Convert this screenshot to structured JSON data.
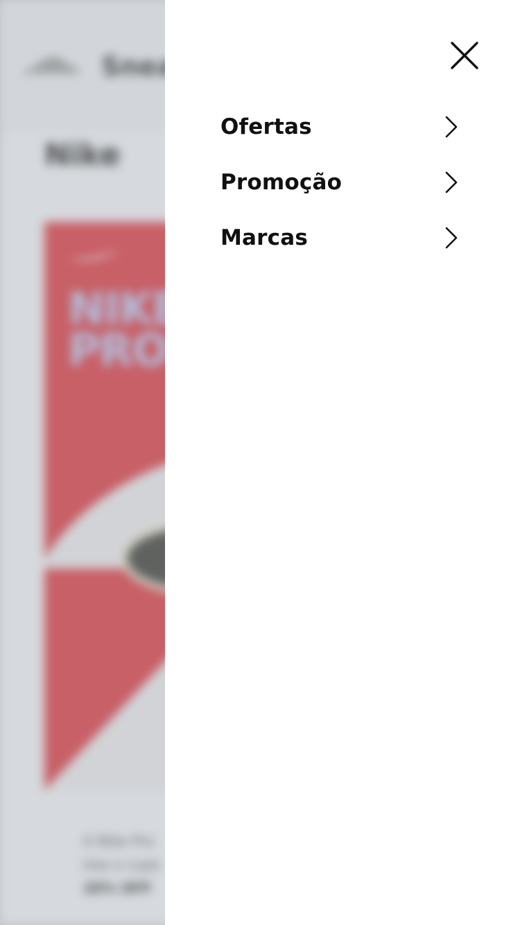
{
  "background_page": {
    "brand_word": "Snea",
    "title": "Nike",
    "banner_text_line1": "NIKE",
    "banner_text_line2": "PRO",
    "description_line1": "A Nike Pro",
    "description_line2": "Use o cupo",
    "description_line3": "20% OFF"
  },
  "drawer": {
    "close_icon": "close-icon",
    "menu": [
      {
        "label": "Ofertas",
        "icon": "chevron-right-icon"
      },
      {
        "label": "Promoção",
        "icon": "chevron-right-icon"
      },
      {
        "label": "Marcas",
        "icon": "chevron-right-icon"
      }
    ]
  },
  "colors": {
    "drawer_bg": "#ffffff",
    "text": "#111111",
    "banner_red": "#d9363e",
    "backdrop": "#c9cbcf"
  }
}
